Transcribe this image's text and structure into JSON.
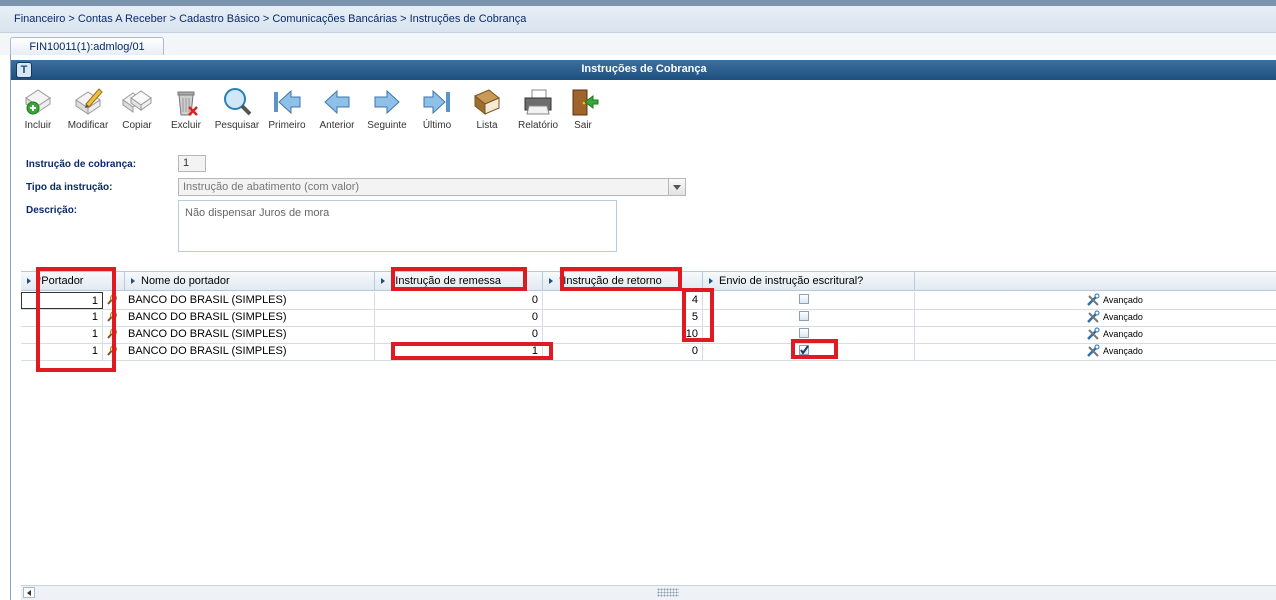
{
  "breadcrumb": "Financeiro > Contas A Receber > Cadastro Básico > Comunicações Bancárias > Instruções de Cobrança",
  "tab": {
    "label": "FIN10011(1):admlog/01"
  },
  "window": {
    "title": "Instruções de Cobrança"
  },
  "toolbar": {
    "incluir": "Incluir",
    "modificar": "Modificar",
    "copiar": "Copiar",
    "excluir": "Excluir",
    "pesquisar": "Pesquisar",
    "primeiro": "Primeiro",
    "anterior": "Anterior",
    "seguinte": "Seguinte",
    "ultimo": "Último",
    "lista": "Lista",
    "relatorio": "Relatório",
    "sair": "Sair"
  },
  "form": {
    "instrucao_label": "Instrução de cobrança:",
    "instrucao_value": "1",
    "tipo_label": "Tipo da instrução:",
    "tipo_value": "Instrução de abatimento (com valor)",
    "descricao_label": "Descrição:",
    "descricao_value": "Não dispensar Juros de mora"
  },
  "grid": {
    "headers": {
      "portador": "*Portador",
      "nome": "Nome do portador",
      "remessa": "*Instrução de remessa",
      "retorno": "*Instrução de retorno",
      "envio": "Envio de instrução escritural?"
    },
    "advanced_label": "Avançado",
    "rows": [
      {
        "portador": "1",
        "nome": "BANCO DO BRASIL (SIMPLES)",
        "remessa": "0",
        "retorno": "4",
        "envio": false
      },
      {
        "portador": "1",
        "nome": "BANCO DO BRASIL (SIMPLES)",
        "remessa": "0",
        "retorno": "5",
        "envio": false
      },
      {
        "portador": "1",
        "nome": "BANCO DO BRASIL (SIMPLES)",
        "remessa": "0",
        "retorno": "10",
        "envio": false
      },
      {
        "portador": "1",
        "nome": "BANCO DO BRASIL (SIMPLES)",
        "remessa": "1",
        "retorno": "0",
        "envio": true
      }
    ]
  },
  "colors": {
    "highlight": "#e01a22",
    "titlebar": "#1c4f80",
    "label": "#0a2a6a"
  }
}
